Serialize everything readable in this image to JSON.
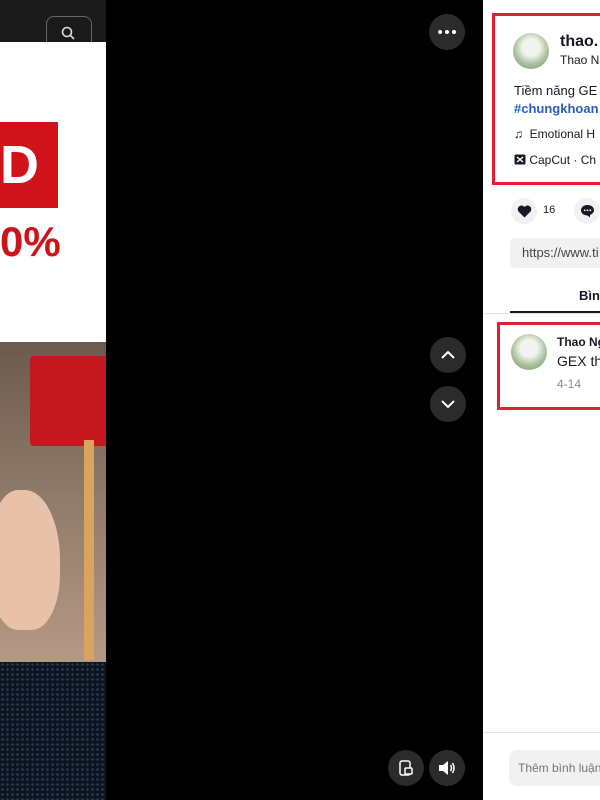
{
  "video": {
    "overlay_letter": "D",
    "overlay_percent": "0%"
  },
  "controls": {
    "more_icon": "more-horizontal-icon",
    "prev_icon": "chevron-up-icon",
    "next_icon": "chevron-down-icon",
    "miniplayer_icon": "miniplayer-icon",
    "volume_icon": "volume-icon"
  },
  "post": {
    "username": "thao.",
    "display_name": "Thao N",
    "description": "Tiềm năng GE",
    "hashtag": "#chungkhoan",
    "music": "Emotional H",
    "capcut": "CapCut · Ch",
    "likes": "16"
  },
  "link": {
    "url": "https://www.ti"
  },
  "tabs": {
    "comments": "Bình"
  },
  "comment": {
    "author": "Thao Ng",
    "text": "GEX th",
    "date": "4-14"
  },
  "input": {
    "placeholder": "Thêm bình luận"
  },
  "colors": {
    "highlight": "#e02030",
    "hashtag": "#2b5db9"
  }
}
